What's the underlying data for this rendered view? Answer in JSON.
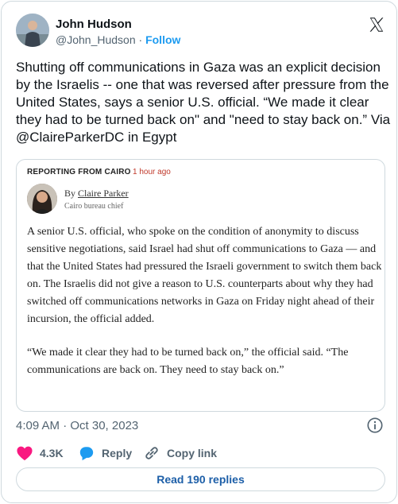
{
  "author": {
    "name": "John Hudson",
    "handle": "@John_Hudson",
    "separator": " · ",
    "follow_label": "Follow"
  },
  "tweet": {
    "text": "Shutting off communications in Gaza was an explicit decision by the Israelis -- one that was reversed after pressure from the United States, says a senior U.S. official. “We made it clear they had to be turned back on\" and \"need to stay back on.” Via @ClaireParkerDC in Egypt"
  },
  "article": {
    "kicker": "REPORTING FROM CAIRO",
    "kicker_time": "1 hour ago",
    "byline_prefix": "By ",
    "byline_name": "Claire Parker",
    "byline_title": "Cairo bureau chief",
    "paragraph_1": "A senior U.S. official, who spoke on the condition of anonymity to discuss sensitive negotiations, said Israel had shut off communications to Gaza — and that the United States had pressured the Israeli government to switch them back on. The Israelis did not give a reason to U.S. counterparts about why they had switched off communications networks in Gaza on Friday night ahead of their incursion, the official added.",
    "paragraph_2": "“We made it clear they had to be turned back on,” the official said. “The communications are back on. They need to stay back on.”"
  },
  "meta": {
    "timestamp": "4:09 AM · Oct 30, 2023"
  },
  "actions": {
    "like_count": "4.3K",
    "reply_label": "Reply",
    "copy_label": "Copy link"
  },
  "read_replies_label": "Read 190 replies",
  "colors": {
    "accent": "#1d9bf0",
    "like": "#f91880",
    "kicker_time": "#c0392b",
    "border": "#cfd9de"
  },
  "icons": {
    "logo": "x-logo-icon",
    "info": "info-icon",
    "like": "heart-icon",
    "reply": "reply-bubble-icon",
    "copy": "link-icon"
  }
}
